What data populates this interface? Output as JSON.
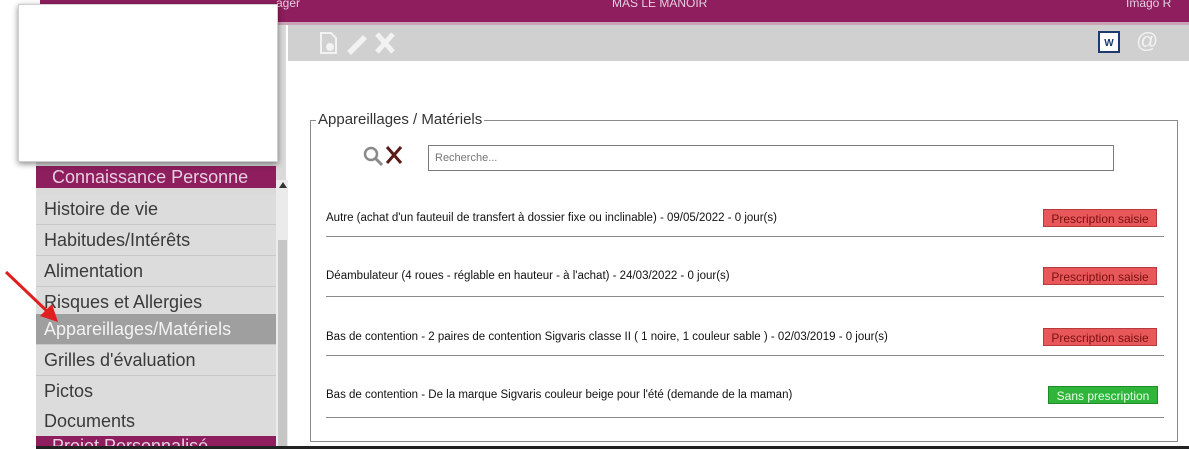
{
  "topbar": {
    "left_text": "ager",
    "center_text": "MAS LE MANOIR",
    "right_text": "Imago R"
  },
  "toolbar": {
    "icons": [
      "add-document-icon",
      "edit-pencil-icon",
      "delete-x-icon",
      "word-export-icon",
      "email-at-icon"
    ],
    "word_label": "W",
    "at_label": "@"
  },
  "sidebar": {
    "header_top": "Connaissance Personne",
    "items": [
      {
        "label": "Histoire de vie"
      },
      {
        "label": "Habitudes/Intérêts"
      },
      {
        "label": "Alimentation"
      },
      {
        "label": "Risques et Allergies"
      },
      {
        "label": "Appareillages/Matériels",
        "active": true
      },
      {
        "label": "Grilles d'évaluation"
      },
      {
        "label": "Pictos"
      },
      {
        "label": "Documents"
      }
    ],
    "header_bottom": "Projet Personnalisé"
  },
  "section": {
    "title": "Appareillages / Matériels",
    "search_placeholder": "Recherche..."
  },
  "rows": [
    {
      "text": "Autre (achat d'un fauteuil de transfert à dossier fixe ou inclinable) - 09/05/2022 - 0 jour(s)",
      "status": "Prescription saisie",
      "status_color": "#e8585a"
    },
    {
      "text": "Déambulateur (4 roues - réglable en hauteur - à l'achat) - 24/03/2022 - 0 jour(s)",
      "status": "Prescription saisie",
      "status_color": "#e8585a"
    },
    {
      "text": "Bas de contention - 2 paires de contention Sigvaris classe II ( 1 noire, 1 couleur sable ) - 02/03/2019 - 0 jour(s)",
      "status": "Prescription saisie",
      "status_color": "#e8585a"
    },
    {
      "text": "Bas de contention - De la marque Sigvaris couleur beige pour l'été (demande de la maman)",
      "status": "Sans prescription",
      "status_color": "#2fb53a"
    }
  ],
  "colors": {
    "brand": "#8e1e5e",
    "arrow": "#e02020"
  }
}
